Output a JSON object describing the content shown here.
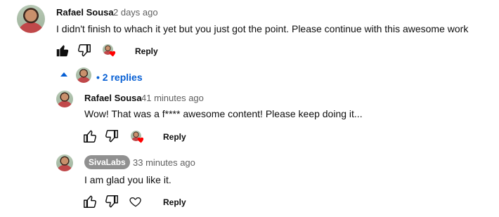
{
  "comment": {
    "author": "Rafael Sousa",
    "time": "2 days ago",
    "text": "I didn't finish to whach it yet but you just got the point. Please continue with this awesome work",
    "reply_label": "Reply"
  },
  "replies_toggle": {
    "label": "2 replies"
  },
  "replies": [
    {
      "author": "Rafael Sousa",
      "time": "41 minutes ago",
      "text": "Wow! That was a f**** awesome content! Please keep doing it...",
      "reply_label": "Reply"
    },
    {
      "author": "SivaLabs",
      "time": "33 minutes ago",
      "text": "I am glad you like it.",
      "reply_label": "Reply"
    }
  ],
  "colors": {
    "link_blue": "#065fd4",
    "heart_red": "#ff0000",
    "badge_gray": "#909090"
  }
}
